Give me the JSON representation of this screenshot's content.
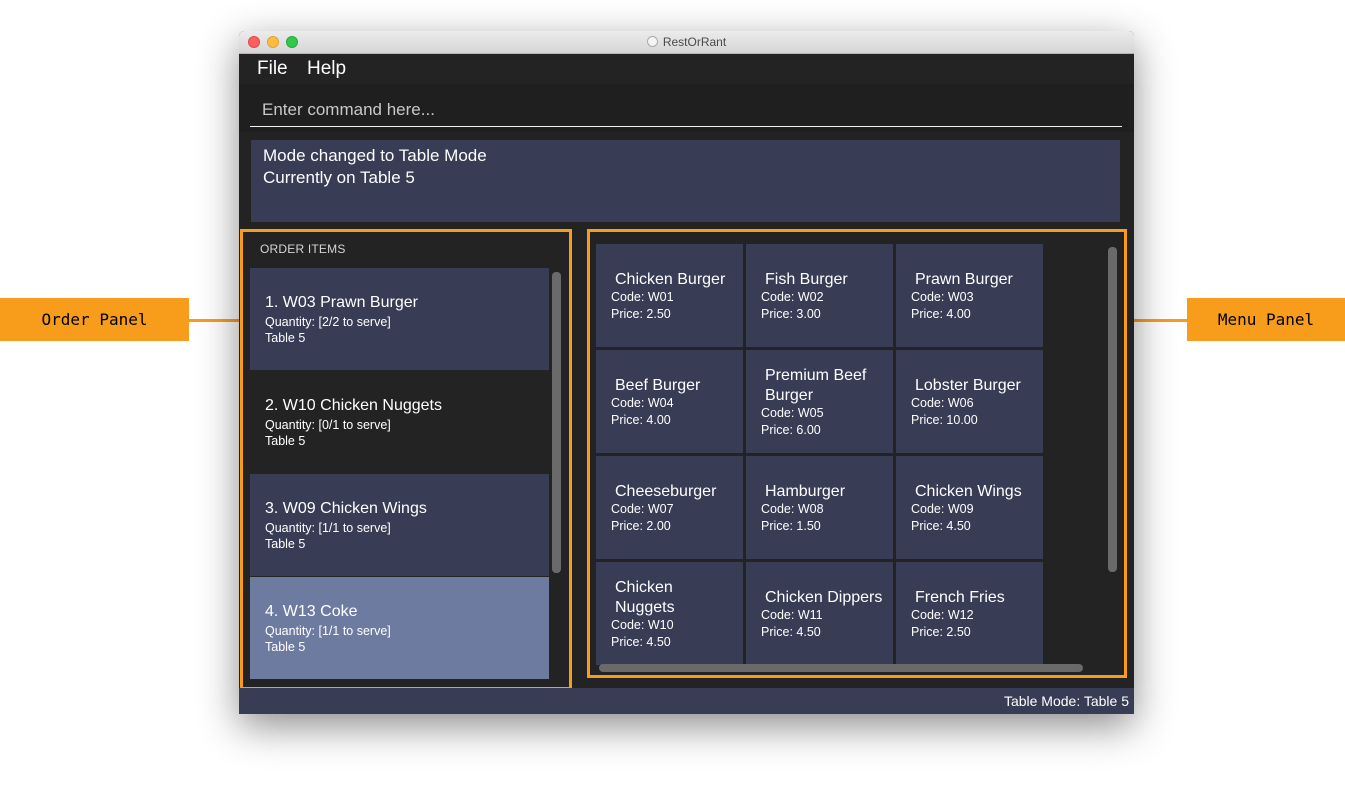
{
  "window": {
    "title": "RestOrRant"
  },
  "menubar": {
    "items": [
      "File",
      "Help"
    ]
  },
  "command_box": {
    "placeholder": "Enter command here..."
  },
  "result_display": {
    "lines": [
      "Mode changed to Table Mode",
      "Currently on Table 5"
    ]
  },
  "order_panel": {
    "title": "ORDER ITEMS",
    "items": [
      {
        "title": "1.  W03 Prawn Burger",
        "quantity": "Quantity: [2/2 to serve]",
        "table": "Table 5"
      },
      {
        "title": "2.  W10 Chicken Nuggets",
        "quantity": "Quantity: [0/1 to serve]",
        "table": "Table 5"
      },
      {
        "title": "3.  W09 Chicken Wings",
        "quantity": "Quantity: [1/1 to serve]",
        "table": "Table 5"
      },
      {
        "title": "4.  W13 Coke",
        "quantity": "Quantity: [1/1 to serve]",
        "table": "Table 5"
      }
    ]
  },
  "menu_panel": {
    "items": [
      {
        "name": "Chicken Burger",
        "code": "Code: W01",
        "price": "Price: 2.50"
      },
      {
        "name": "Fish Burger",
        "code": "Code: W02",
        "price": "Price: 3.00"
      },
      {
        "name": "Prawn Burger",
        "code": "Code: W03",
        "price": "Price: 4.00"
      },
      {
        "name": "Beef Burger",
        "code": "Code: W04",
        "price": "Price: 4.00"
      },
      {
        "name": "Premium Beef Burger",
        "code": "Code: W05",
        "price": "Price: 6.00"
      },
      {
        "name": "Lobster Burger",
        "code": "Code: W06",
        "price": "Price: 10.00"
      },
      {
        "name": "Cheeseburger",
        "code": "Code: W07",
        "price": "Price: 2.00"
      },
      {
        "name": "Hamburger",
        "code": "Code: W08",
        "price": "Price: 1.50"
      },
      {
        "name": "Chicken Wings",
        "code": "Code: W09",
        "price": "Price: 4.50"
      },
      {
        "name": "Chicken Nuggets",
        "code": "Code: W10",
        "price": "Price: 4.50"
      },
      {
        "name": "Chicken Dippers",
        "code": "Code: W11",
        "price": "Price: 4.50"
      },
      {
        "name": "French Fries",
        "code": "Code: W12",
        "price": "Price: 2.50"
      }
    ]
  },
  "status_bar": {
    "text": "Table Mode: Table 5"
  },
  "annotations": {
    "order_callout": "Order Panel",
    "menu_callout": "Menu Panel"
  },
  "colors": {
    "accent": "#f89c1c",
    "panel_dark": "#232323",
    "card": "#383c54",
    "order_item_alt": "#232323",
    "order_item_selected": "#6e7ba0"
  }
}
